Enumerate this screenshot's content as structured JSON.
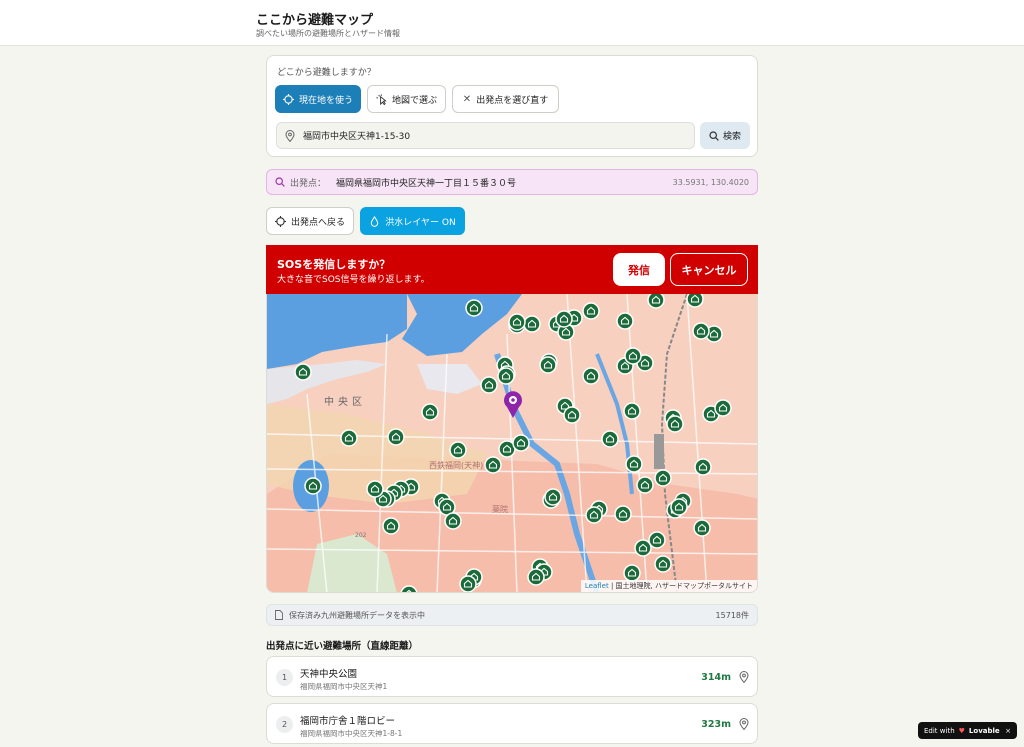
{
  "header": {
    "title": "ここから避難マップ",
    "subtitle": "調べたい場所の避難場所とハザード情報"
  },
  "start_card": {
    "question": "どこから避難しますか？",
    "btn_current": "現在地を使う",
    "btn_map": "地図で選ぶ",
    "btn_reset": "出発点を選び直す",
    "address": "福岡市中央区天神1-15-30",
    "btn_search": "検索"
  },
  "origin": {
    "label": "出発点：",
    "value": "福岡県福岡市中央区天神一丁目１５番３０号",
    "coords": "33.5931, 130.4020"
  },
  "controls": {
    "back_label": "出発点へ戻る",
    "flood_label": "洪水レイヤー ON"
  },
  "sos": {
    "title": "SOSを発信しますか？",
    "subtitle": "大きな音でSOS信号を繰り返します。",
    "send": "発信",
    "cancel": "キャンセル"
  },
  "map": {
    "label_ward": "中央区",
    "label_station": "西鉄福岡(天神)",
    "label_area": "薬院",
    "label_road": "202",
    "attribution_leaflet": "Leaflet",
    "attribution_rest": "| 国土地理院, ハザードマップポータルサイト"
  },
  "data_info": {
    "text": "保存済み九州避難場所データを表示中",
    "count": "15718件"
  },
  "list": {
    "heading": "出発点に近い避難場所（直線距離）",
    "items": [
      {
        "num": "1",
        "name": "天神中央公園",
        "address": "福岡県福岡市中央区天神1",
        "distance": "314m"
      },
      {
        "num": "2",
        "name": "福岡市庁舎１階ロビー",
        "address": "福岡県福岡市中央区天神1-8-1",
        "distance": "323m"
      }
    ]
  },
  "badge": {
    "prefix": "Edit with",
    "brand": "Lovable",
    "close": "×"
  },
  "colors": {
    "primary": "#1d7fb8",
    "flood_button": "#0aa2e0",
    "sos_red": "#d10000",
    "marker_green": "#1b6b3a",
    "origin_pin": "#8e24aa"
  }
}
